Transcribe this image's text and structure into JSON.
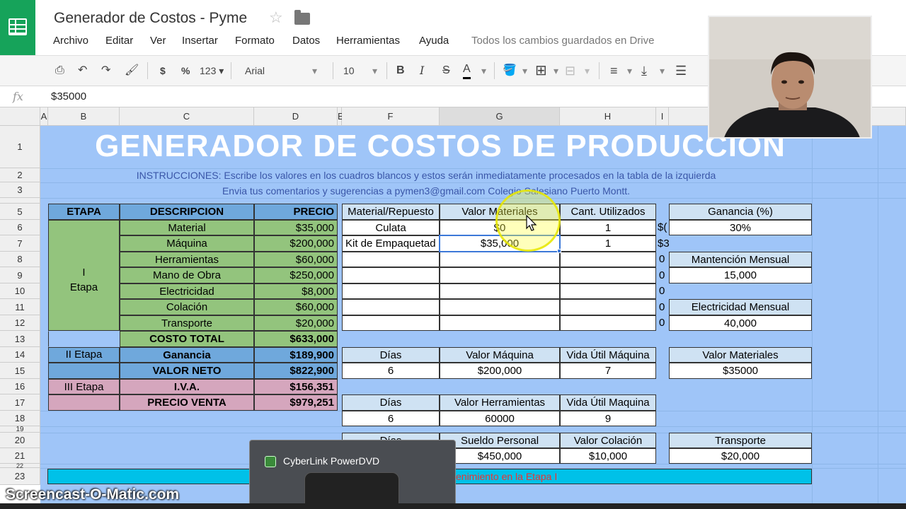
{
  "window": {
    "doc_title": "Generador de Costos - Pyme",
    "menu": [
      "Archivo",
      "Editar",
      "Ver",
      "Insertar",
      "Formato",
      "Datos",
      "Herramientas",
      "Ayuda"
    ],
    "saved_status": "Todos los cambios guardados en Drive"
  },
  "toolbar": {
    "currency": "$",
    "percent": "%",
    "number_format": "123",
    "font": "Arial",
    "font_size": "10",
    "bold": "B",
    "italic": "I",
    "strike": "S",
    "text_color": "A"
  },
  "formula_bar": {
    "fx": "fx",
    "value": "$35000"
  },
  "columns": [
    "A",
    "B",
    "C",
    "D",
    "E",
    "F",
    "G",
    "H",
    "I"
  ],
  "rows": [
    "1",
    "2",
    "3",
    "5",
    "6",
    "7",
    "8",
    "9",
    "10",
    "11",
    "12",
    "13",
    "14",
    "15",
    "16",
    "17",
    "18",
    "19",
    "20",
    "21",
    "22",
    "23"
  ],
  "sheet": {
    "title": "GENERADOR DE COSTOS DE PRODUCCION",
    "instructions": "INSTRUCCIONES: Escribe los valores en los cuadros blancos y estos serán inmediatamente procesados en la tabla de la izquierda",
    "contact": "Envia tus comentarios y sugerencias a pymen3@gmail.com Colegio Salesiano Puerto Montt.",
    "left_table": {
      "headers": {
        "etapa": "ETAPA",
        "descripcion": "DESCRIPCION",
        "precio": "PRECIO"
      },
      "etapa1_top": "I",
      "etapa1_bottom": "Etapa",
      "rows1": [
        {
          "desc": "Material",
          "price": "$35,000"
        },
        {
          "desc": "Máquina",
          "price": "$200,000"
        },
        {
          "desc": "Herramientas",
          "price": "$60,000"
        },
        {
          "desc": "Mano de Obra",
          "price": "$250,000"
        },
        {
          "desc": "Electricidad",
          "price": "$8,000"
        },
        {
          "desc": "Colación",
          "price": "$60,000"
        },
        {
          "desc": "Transporte",
          "price": "$20,000"
        }
      ],
      "costo_total": {
        "label": "COSTO TOTAL",
        "value": "$633,000"
      },
      "etapa2": "II Etapa",
      "ganancia": {
        "label": "Ganancia",
        "value": "$189,900"
      },
      "valor_neto": {
        "label": "VALOR NETO",
        "value": "$822,900"
      },
      "etapa3": "III Etapa",
      "iva": {
        "label": "I.V.A.",
        "value": "$156,351"
      },
      "precio_venta": {
        "label": "PRECIO VENTA",
        "value": "$979,251"
      }
    },
    "materials_table": {
      "headers": [
        "Material/Repuesto",
        "Valor Materiales",
        "Cant. Utilizados"
      ],
      "rows": [
        {
          "material": "Culata",
          "valor": "$0",
          "cant": "1",
          "i": "$("
        },
        {
          "material": "Kit de Empaquetad",
          "valor": "$35,000",
          "cant": "1",
          "i": "$3"
        }
      ],
      "i_zeros": [
        "0",
        "0",
        "0",
        "0",
        "0"
      ]
    },
    "maquina_table": {
      "headers": [
        "Días",
        "Valor Máquina",
        "Vida Útil Máquina"
      ],
      "values": [
        "6",
        "$200,000",
        "7"
      ]
    },
    "herramientas_table": {
      "headers": [
        "Días",
        "Valor Herramientas",
        "Vida Útil Maquina"
      ],
      "values": [
        "6",
        "60000",
        "9"
      ]
    },
    "personal_table": {
      "headers": [
        "Días",
        "Sueldo Personal",
        "Valor Colación"
      ],
      "values": [
        "",
        "$450,000",
        "$10,000"
      ]
    },
    "right_panel": {
      "ganancia_label": "Ganancia (%)",
      "ganancia_value": "30%",
      "mantencion_label": "Mantención Mensual",
      "mantencion_value": "15,000",
      "electricidad_label": "Electricidad Mensual",
      "electricidad_value": "40,000",
      "valor_materiales_label": "Valor Materiales",
      "valor_materiales_value": "$35000",
      "transporte_label": "Transporte",
      "transporte_value": "$20,000"
    },
    "banner_text": "enimiento en la Etapa I"
  },
  "overlay": {
    "powerdvd_title": "CyberLink PowerDVD",
    "watermark": "Screencast-O-Matic.com"
  }
}
